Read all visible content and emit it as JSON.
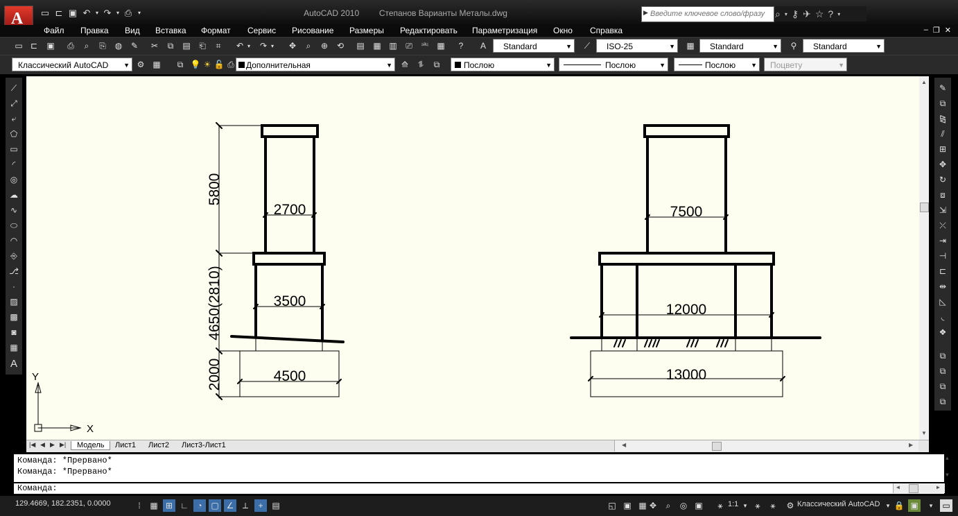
{
  "app": {
    "logo_letter": "A",
    "title": "AutoCAD 2010",
    "document": "Степанов Варианты Металы.dwg",
    "search_placeholder": "Введите ключевое слово/фразу"
  },
  "menu": [
    "Файл",
    "Правка",
    "Вид",
    "Вставка",
    "Формат",
    "Сервис",
    "Рисование",
    "Размеры",
    "Редактировать",
    "Параметризация",
    "Окно",
    "Справка"
  ],
  "styles_toolbar": {
    "text_style": "Standard",
    "dim_style": "ISO-25",
    "table_style": "Standard",
    "multileader_style": "Standard"
  },
  "layers_toolbar": {
    "workspace": "Классический AutoCAD",
    "layer": "Дополнительная",
    "color": "Послою",
    "linetype": "Послою",
    "lineweight": "Послою",
    "plotstyle": "Поцвету"
  },
  "drawing": {
    "left_view": {
      "dims_vertical": [
        "5800",
        "4650(2810)",
        "2000"
      ],
      "dims_horizontal": [
        "2700",
        "3500",
        "4500"
      ]
    },
    "right_view": {
      "dims_horizontal": [
        "7500",
        "12000",
        "13000"
      ]
    },
    "ucs": {
      "x_label": "X",
      "y_label": "Y"
    }
  },
  "layout_tabs": [
    "Модель",
    "Лист1",
    "Лист2",
    "Лист3-Лист1"
  ],
  "command": {
    "history": [
      "Команда: *Прервано*",
      "Команда: *Прервано*"
    ],
    "prompt": "Команда:"
  },
  "status": {
    "coords": "129.4669, 182.2351, 0.0000",
    "scale": "1:1",
    "workspace": "Классический AutoCAD"
  },
  "colors": {
    "canvas": "#fdfdf0",
    "chrome": "#2a2a2a",
    "line": "#000000"
  }
}
